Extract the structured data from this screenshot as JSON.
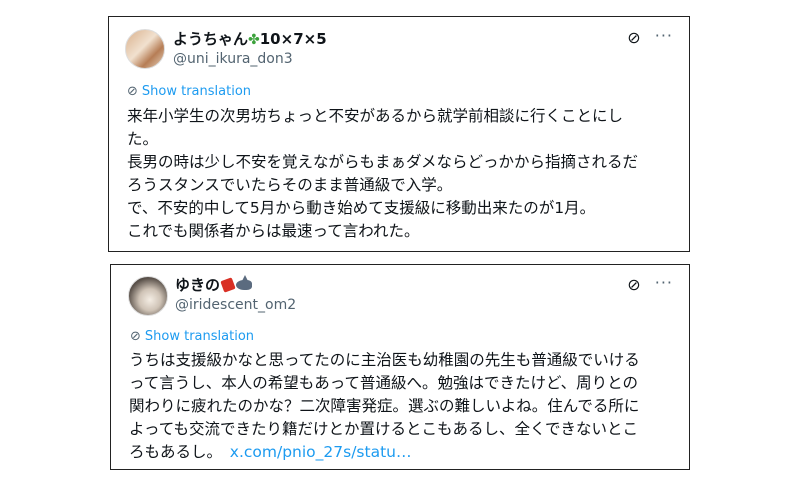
{
  "posts": [
    {
      "display_name": "ようちゃん",
      "name_suffix": "10×7×5",
      "handle": "@uni_ikura_don3",
      "translation_label": "Show translation",
      "lines": [
        "来年小学生の次男坊ちょっと不安があるから就学前相談に行くことにし",
        "た。",
        "長男の時は少し不安を覚えながらもまぁダメならどっかから指摘されるだ",
        "ろうスタンスでいたらそのまま普通級で入学。",
        "で、不安的中して5月から動き始めて支援級に移動出来たのが1月。",
        "これでも関係者からは最速って言われた。"
      ]
    },
    {
      "display_name": "ゆきの",
      "handle": "@iridescent_om2",
      "translation_label": "Show translation",
      "lines": [
        "うちは支援級かなと思ってたのに主治医も幼稚園の先生も普通級でいける",
        "って言うし、本人の希望もあって普通級へ。勉強はできたけど、周りとの",
        "関わりに疲れたのかな？二次障害発症。選ぶの難しいよね。住んでる所に",
        "よっても交流できたり籍だけとか置けるとこもあるし、全くできないとこ",
        "ろもあるし。"
      ],
      "link_text": "x.com/pnio_27s/statu…"
    }
  ],
  "icons": {
    "clover": "four-leaf-clover-emoji",
    "grok": "grok-icon",
    "more": "more-options-icon",
    "translate": "translate-icon"
  },
  "colors": {
    "link": "#1d9bf0",
    "handle": "#536471",
    "text": "#0f1419"
  }
}
